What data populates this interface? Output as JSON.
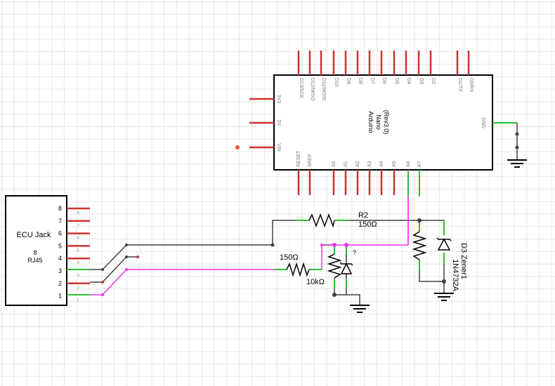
{
  "arduino": {
    "name_line1": "Arduino",
    "name_line2": "Nano",
    "name_line3": "(Rev3.0)",
    "top_pins": [
      "D13/SCK",
      "D12/MISO",
      "D11/MOSI",
      "D10",
      "D9",
      "D8",
      "D7",
      "D6",
      "D5",
      "D4",
      "D3",
      "D2",
      "D1/TX",
      "D0/RX"
    ],
    "bottom_pins": [
      "RESET",
      "AREF",
      "A0",
      "A1",
      "A2",
      "A3",
      "A4",
      "A5",
      "A6",
      "A7"
    ],
    "left_pins": [
      "3V3",
      "5V",
      "VIN"
    ],
    "right_pins": [
      "GND"
    ]
  },
  "ecu": {
    "title": "ECU Jack",
    "sub1": "8",
    "sub2": "RJ45",
    "pin_numbers": [
      "8",
      "7",
      "6",
      "5",
      "4",
      "3",
      "2",
      "1"
    ]
  },
  "r2": {
    "label": "R2",
    "value": "150Ω"
  },
  "r_left": {
    "value": "150Ω"
  },
  "r_10k": {
    "value": "10kΩ"
  },
  "zener_small": {
    "label": "?"
  },
  "d3": {
    "label": "D3 Zener1",
    "part": "1N4732A"
  },
  "colors": {
    "wire": "#404040",
    "green": "#33bb33",
    "magenta": "#ee33ee",
    "pin_red": "#cc3333",
    "junction": "#404040"
  }
}
